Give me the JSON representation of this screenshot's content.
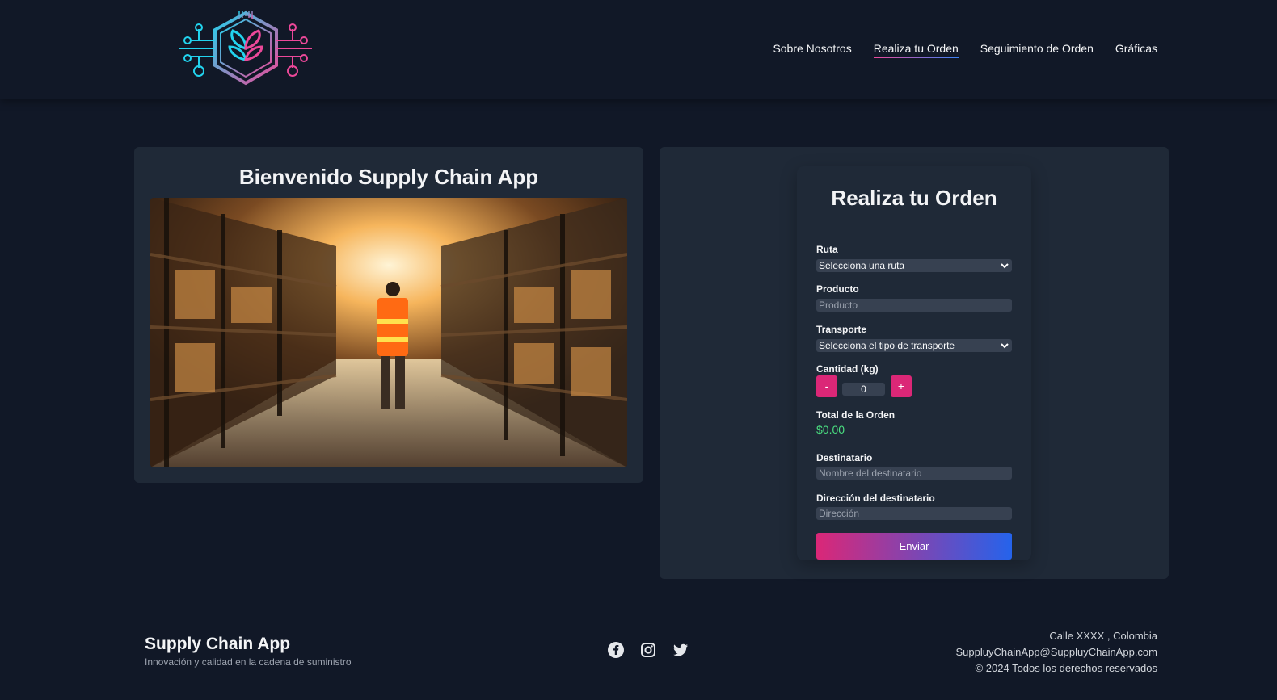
{
  "header": {
    "nav": [
      {
        "label": "Sobre Nosotros",
        "active": false
      },
      {
        "label": "Realiza tu Orden",
        "active": true
      },
      {
        "label": "Seguimiento de Orden",
        "active": false
      },
      {
        "label": "Gráficas",
        "active": false
      }
    ],
    "logo_icon": "circuit-leaf-hexagon-logo"
  },
  "welcome": {
    "title": "Bienvenido Supply Chain App",
    "image": "warehouse-worker-photo"
  },
  "order_form": {
    "title": "Realiza tu Orden",
    "ruta_label": "Ruta",
    "ruta_value": "Selecciona una ruta",
    "producto_label": "Producto",
    "producto_placeholder": "Producto",
    "transporte_label": "Transporte",
    "transporte_value": "Selecciona el tipo de transporte",
    "cantidad_label": "Cantidad (kg)",
    "cantidad_minus": "-",
    "cantidad_value": "0",
    "cantidad_plus": "+",
    "total_label": "Total de la Orden",
    "total_value": "$0.00",
    "destinatario_label": "Destinatario",
    "destinatario_placeholder": "Nombre del destinatario",
    "direccion_label": "Dirección del destinatario",
    "direccion_placeholder": "Dirección",
    "submit_label": "Enviar"
  },
  "footer": {
    "brand": "Supply Chain App",
    "tagline": "Innovación y calidad en la cadena de suministro",
    "socials": [
      "facebook-icon",
      "instagram-icon",
      "twitter-icon"
    ],
    "address": "Calle XXXX , Colombia",
    "email": "SuppluyChainApp@SuppluyChainApp.com",
    "copyright": "© 2024 Todos los derechos reservados"
  },
  "colors": {
    "background": "#111827",
    "card": "#1f2937",
    "accent_pink": "#db2777",
    "accent_blue": "#2563eb",
    "total_green": "#4ade80"
  }
}
